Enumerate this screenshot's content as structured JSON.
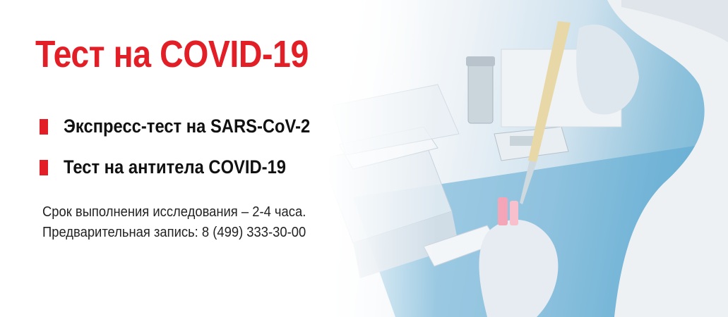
{
  "banner": {
    "title": "Тест на COVID-19",
    "items": [
      {
        "label": "Экспресс-тест на SARS-CoV-2"
      },
      {
        "label": "Тест на антитела COVID-19"
      }
    ],
    "duration": "Срок выполнения исследования – 2-4 часа.",
    "appointment": "Предварительная запись: 8 (499) 333-30-00",
    "accent_color": "#e21e26",
    "icons": [
      "bullet-marker-icon"
    ]
  }
}
